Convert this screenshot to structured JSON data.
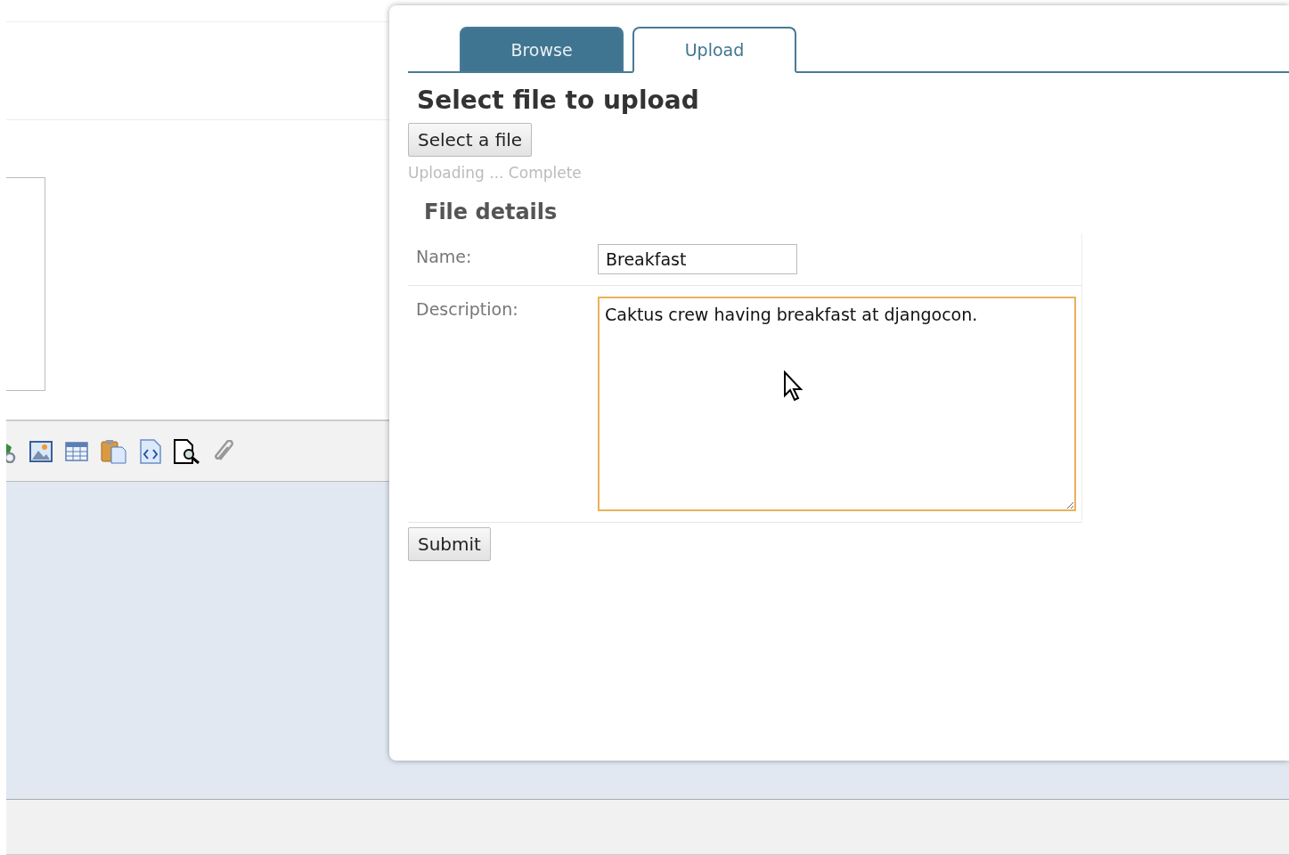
{
  "tabs": [
    {
      "label": "Browse",
      "selected": false
    },
    {
      "label": "Upload",
      "selected": true
    }
  ],
  "upload": {
    "title": "Select file to upload",
    "select_button": "Select a file",
    "status": "Uploading ... Complete"
  },
  "details": {
    "title": "File details",
    "fields": [
      {
        "label": "Name:",
        "kind": "input",
        "value": "Breakfast",
        "focused": false
      },
      {
        "label": "Description:",
        "kind": "textarea",
        "value": "Caktus crew having breakfast at djangocon.",
        "focused": true
      }
    ]
  },
  "submit_button": "Submit"
}
